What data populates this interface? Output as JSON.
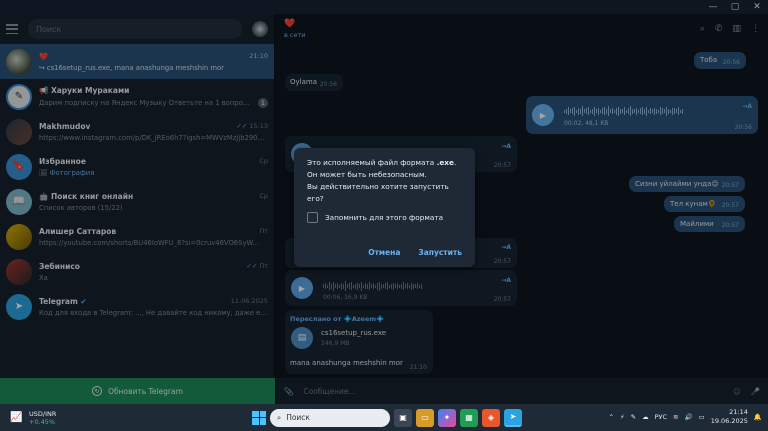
{
  "sidebar": {
    "search_placeholder": "Поиск",
    "chats": [
      {
        "name": "❤️",
        "time": "21:10",
        "preview": "cs16setup_rus.exe, mana anashunga meshshin mor",
        "active": true
      },
      {
        "name": "Харуки Мураками",
        "time": "",
        "preview": "Дарим подписку на Яндекс Музыку  Ответьте на 1 вопро...",
        "badge": "1"
      },
      {
        "name": "Makhmudov",
        "time": "15:13",
        "preview": "https://www.instagram.com/p/DK_jREo6h7?igsh=MWVzMzJjb290M..."
      },
      {
        "name": "Избранное",
        "time": "Ср",
        "preview_hl": "Фотография"
      },
      {
        "name": "Поиск книг онлайн",
        "time": "Ср",
        "preview": "Список авторов (15/22)"
      },
      {
        "name": "Алишер Саттаров",
        "time": "Пт",
        "preview": "https://youtube.com/shorts/BU46IoWFU_8?si=0cruv46VO6SyW..."
      },
      {
        "name": "Зебинисо",
        "time": "Пт",
        "preview": "Ха"
      },
      {
        "name": "Telegram",
        "time": "11.06.2025",
        "preview": "Код для входа в Telegram: ..., Не давайте код никому, даже ес..."
      }
    ],
    "update_label": "Обновить Telegram"
  },
  "header": {
    "title": "❤️",
    "status": "в сети"
  },
  "messages": {
    "m1": {
      "text": "Тоба",
      "time": "20:56"
    },
    "m2": {
      "text": "Oylama",
      "time": "20:56"
    },
    "m3": {
      "meta": "00:02, 48,1 KB",
      "time": "20:56",
      "ta": "→A"
    },
    "m4": {
      "time": "20:57",
      "ta": "→A"
    },
    "m5": {
      "text": "Сизни уйлайми унда😌",
      "time": "20:57"
    },
    "m6": {
      "text": "Тел кунам🌻",
      "time": "20:57"
    },
    "m7": {
      "text": "Майлими",
      "time": "20:57"
    },
    "m8": {
      "time": "20:57",
      "ta": "→A"
    },
    "m9": {
      "meta": "00:06, 16,9 KB",
      "time": "20:57",
      "ta": "→A"
    },
    "m10": {
      "forward": "Переслано от 💠Azeem💠",
      "file": "cs16setup_rus.exe",
      "size": "246,9 MB",
      "caption": "mana anashunga meshshin mor",
      "time": "21:10"
    }
  },
  "composer": {
    "placeholder": "Сообщение..."
  },
  "dialog": {
    "line1": "Это исполняемый файл формата ",
    "ext": ".exe",
    "line1b": ".",
    "line2": "Он может быть небезопасным.",
    "line3": "Вы действительно хотите запустить его?",
    "checkbox": "Запомнить для этого формата",
    "cancel": "Отмена",
    "confirm": "Запустить"
  },
  "taskbar": {
    "stock_name": "USD/INR",
    "stock_change": "+0.45%",
    "search": "Поиск",
    "lang": "РУС",
    "time": "21:14",
    "date": "19.06.2025"
  }
}
